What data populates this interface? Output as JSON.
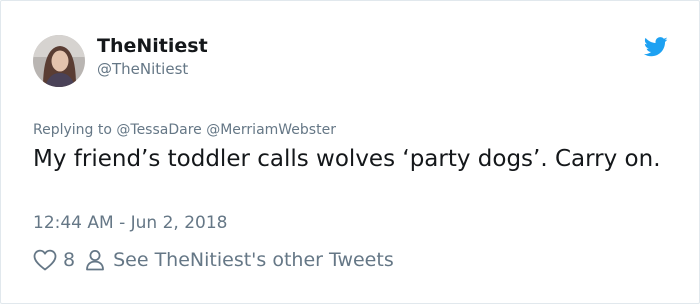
{
  "user": {
    "display_name": "TheNitiest",
    "handle": "@TheNitiest",
    "avatar_icon": "profile-avatar"
  },
  "brand": {
    "icon": "twitter-bird-icon",
    "color": "#1da1f2"
  },
  "tweet": {
    "replying_prefix": "Replying to",
    "replying_to": [
      "@TessaDare",
      "@MerriamWebster"
    ],
    "text": "My friend’s toddler calls wolves ‘party dogs’.  Carry on.",
    "timestamp": "12:44 AM - Jun 2, 2018"
  },
  "actions": {
    "like_icon": "heart-icon",
    "like_count": "8",
    "profile_icon": "person-icon",
    "other_tweets_label": "See TheNitiest's other Tweets"
  },
  "colors": {
    "text": "#14171a",
    "secondary": "#657786",
    "border": "#e1e8ed"
  }
}
